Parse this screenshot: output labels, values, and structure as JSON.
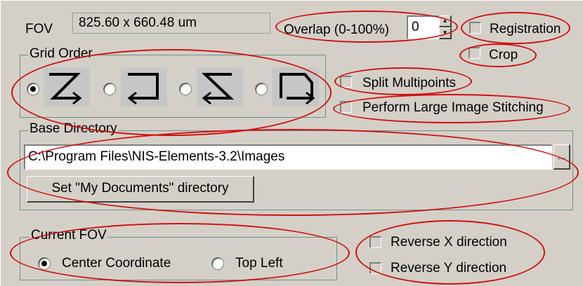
{
  "fov": {
    "label": "FOV",
    "value": "825.60 x 660.48 um"
  },
  "overlap": {
    "label": "Overlap (0-100%)",
    "value": "0"
  },
  "checkboxes": {
    "registration": {
      "label": "Registration",
      "checked": false
    },
    "crop": {
      "label": "Crop",
      "checked": false
    },
    "split_multipoints": {
      "label": "Split Multipoints",
      "checked": false
    },
    "large_image_stitching": {
      "label": "Perform Large Image Stitching",
      "checked": false
    },
    "reverse_x": {
      "label": "Reverse X direction",
      "checked": false
    },
    "reverse_y": {
      "label": "Reverse Y direction",
      "checked": false
    }
  },
  "grid_order": {
    "legend": "Grid Order",
    "options": [
      {
        "icon": "grid-order-z-icon",
        "selected": true
      },
      {
        "icon": "grid-order-snake-return-icon",
        "selected": false
      },
      {
        "icon": "grid-order-reverse-z-icon",
        "selected": false
      },
      {
        "icon": "grid-order-snake-down-icon",
        "selected": false
      }
    ]
  },
  "base_directory": {
    "legend": "Base Directory",
    "path": "C:\\Program Files\\NIS-Elements-3.2\\Images",
    "browse_label": "...",
    "my_documents_button": "Set \"My Documents\" directory"
  },
  "current_fov": {
    "legend": "Current FOV",
    "options": [
      {
        "label": "Center Coordinate",
        "selected": true
      },
      {
        "label": "Top Left",
        "selected": false
      }
    ]
  },
  "colors": {
    "annotation": "#d01010",
    "dialog": "#d4d0c8"
  }
}
